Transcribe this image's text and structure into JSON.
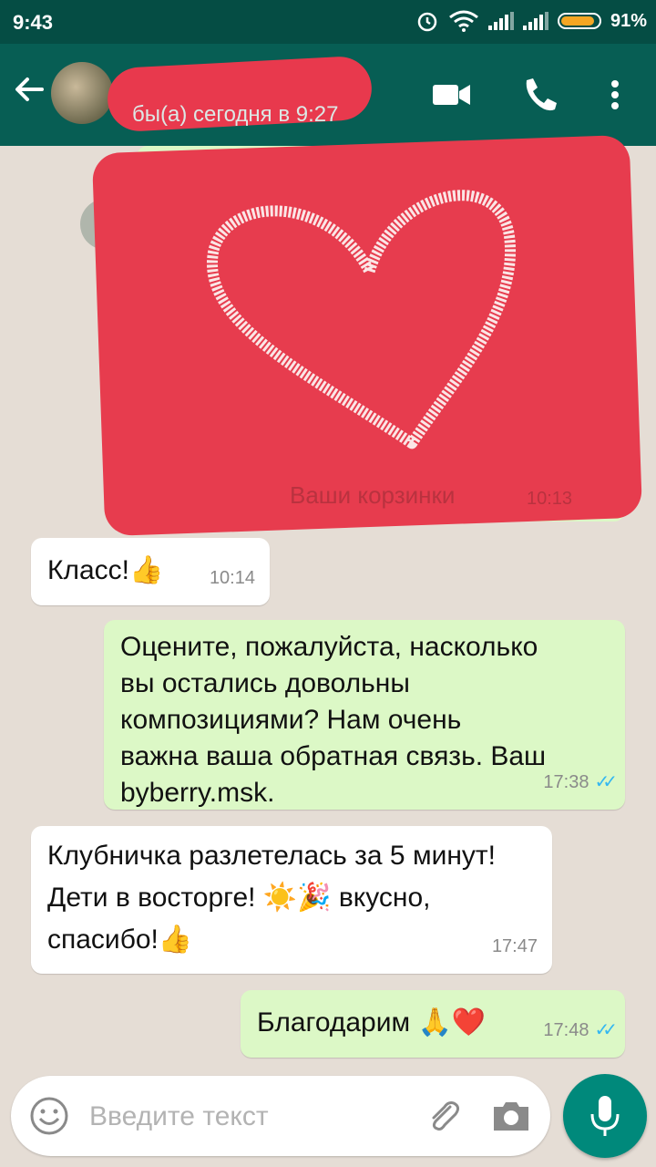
{
  "status_bar": {
    "time": "9:43",
    "battery_percent": "91%",
    "icons": [
      "alarm-icon",
      "wifi-icon",
      "signal-icon",
      "signal-icon",
      "battery-icon"
    ]
  },
  "header": {
    "back_icon": "arrow-left-icon",
    "last_seen": "бы(а) сегодня в 9:27",
    "actions": [
      "video-call-icon",
      "phone-icon",
      "more-vert-icon"
    ]
  },
  "messages": [
    {
      "direction": "out",
      "type": "image",
      "caption": "Ваши корзинки",
      "time": "10:13"
    },
    {
      "direction": "in",
      "text": "Класс!",
      "emoji": "👍",
      "time": "10:14"
    },
    {
      "direction": "out",
      "lines": [
        "Оцените, пожалуйста, насколько",
        "вы остались довольны",
        "композициями? Нам очень",
        "важна ваша обратная связь. Ваш",
        "byberry.msk."
      ],
      "time": "17:38"
    },
    {
      "direction": "in",
      "line1": "Клубничка разлетелась за 5 минут!",
      "line2_a": "Дети в восторге! ",
      "emoji_sun": "☀️",
      "emoji_party": "🎉",
      "line2_b": " вкусно,",
      "line3": "спасибо!",
      "emoji_thumb": "👍",
      "time": "17:47"
    },
    {
      "direction": "out",
      "text": "Благодарим",
      "emoji_pray": "🙏",
      "emoji_heart": "❤️",
      "time": "17:48"
    }
  ],
  "input": {
    "placeholder": "Введите текст",
    "icons": [
      "emoji-icon",
      "attach-icon",
      "camera-icon",
      "mic-icon"
    ]
  },
  "colors": {
    "header": "#075e54",
    "status_bar": "#054d44",
    "outgoing_bubble": "#dcf8c6",
    "incoming_bubble": "#ffffff",
    "read_ticks": "#34b7f1",
    "mic_button": "#00897b",
    "redaction": "#e73c4e"
  }
}
